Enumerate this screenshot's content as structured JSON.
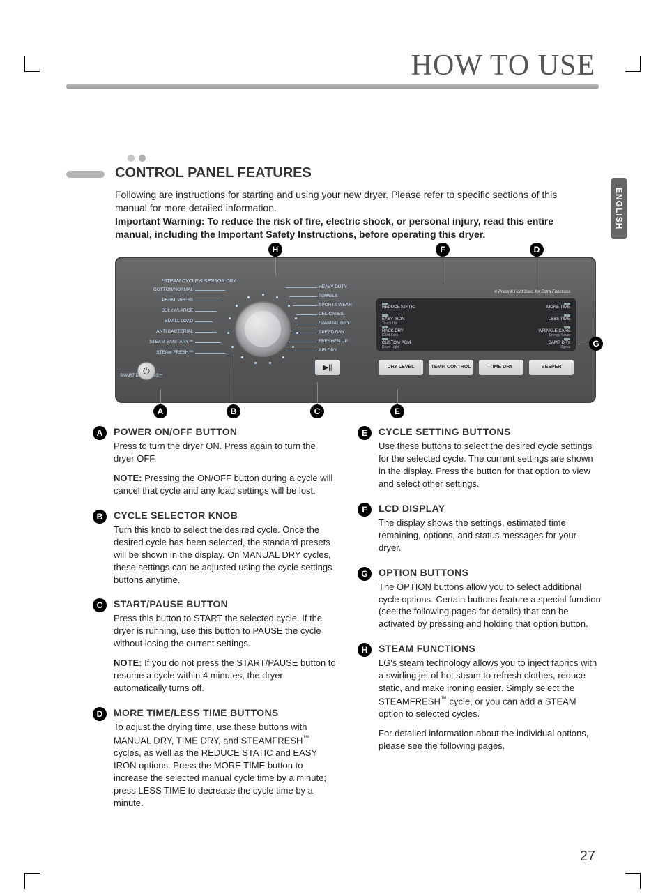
{
  "page_title": "HOW TO USE",
  "language_tab": "ENGLISH",
  "page_number": "27",
  "section_heading": "CONTROL PANEL FEATURES",
  "intro_text": "Following are instructions for starting and using your new dryer. Please refer to specific sections of this manual for more detailed information.",
  "warning_text": "Important Warning: To reduce the risk of fire, electric shock, or personal injury, read this entire manual, including the Important Safety Instructions, before operating this dryer.",
  "panel": {
    "steam_header": "*STEAM CYCLE & SENSOR DRY",
    "left_labels": [
      "COTTON/NORMAL",
      "PERM. PRESS",
      "BULKY/LARGE",
      "SMALL LOAD",
      "ANTI BACTERIAL",
      "STEAM SANITARY™",
      "STEAM FRESH™"
    ],
    "right_labels": [
      "HEAVY DUTY",
      "TOWELS",
      "SPORTS WEAR",
      "DELICATES",
      "*MANUAL DRY",
      "SPEED DRY",
      "FRESHEN UP",
      "AIR DRY"
    ],
    "hold_note": "※ Press & Hold 3sec. for Extra Functions",
    "lcd_left": [
      {
        "t": "REDUCE STATIC"
      },
      {
        "t": "EASY IRON",
        "s": "Touch Up"
      },
      {
        "t": "RACK DRY",
        "s": "Child Lock"
      },
      {
        "t": "CUSTOM PGM",
        "s": "Drum Light"
      }
    ],
    "lcd_right": [
      {
        "t": "MORE TIME"
      },
      {
        "t": "LESS TIME"
      },
      {
        "t": "WRINKLE CARE",
        "s": "Energy Saver"
      },
      {
        "t": "DAMP DRY",
        "s": "Signal"
      }
    ],
    "buttons": [
      "DRY LEVEL",
      "TEMP. CONTROL",
      "TIME DRY",
      "BEEPER"
    ],
    "power_icon": "⏻",
    "play_icon": "▶||",
    "smart_diag": "SMART DIAGNOSIS™"
  },
  "callouts": {
    "A": "A",
    "B": "B",
    "C": "C",
    "D": "D",
    "E": "E",
    "F": "F",
    "G": "G",
    "H": "H"
  },
  "features": [
    {
      "id": "A",
      "title": "POWER ON/OFF BUTTON",
      "paras": [
        "Press to turn the dryer ON. Press again to turn the dryer OFF.",
        "<span class='nb'>NOTE:</span> Pressing the ON/OFF button during a cycle will cancel that cycle and any load settings will be lost."
      ]
    },
    {
      "id": "B",
      "title": "CYCLE SELECTOR KNOB",
      "paras": [
        "Turn this knob to select the desired cycle. Once the desired cycle has been selected, the standard presets will be shown in the display. On MANUAL DRY cycles, these settings can be adjusted using the cycle settings buttons anytime."
      ]
    },
    {
      "id": "C",
      "title": "START/PAUSE BUTTON",
      "paras": [
        "Press this button to START the selected cycle. If the dryer is running, use this button to PAUSE the cycle without losing the current settings.",
        "<span class='nb'>NOTE:</span> If you do not press the START/PAUSE button to resume a cycle within 4 minutes, the dryer automatically turns off."
      ]
    },
    {
      "id": "D",
      "title": "MORE TIME/LESS TIME BUTTONS",
      "paras": [
        "To adjust the drying time, use these buttons with MANUAL DRY, TIME DRY, and STEAMFRESH<sup>™</sup> cycles, as well as the REDUCE STATIC and EASY IRON options. Press the MORE TIME button to increase the selected manual cycle time by a minute; press LESS TIME to decrease the cycle time by a minute."
      ]
    },
    {
      "id": "E",
      "title": "CYCLE SETTING BUTTONS",
      "paras": [
        "Use these buttons to select the desired cycle settings for the selected cycle. The current settings are shown in the display. Press the button for that option to view and select other settings."
      ]
    },
    {
      "id": "F",
      "title": "LCD DISPLAY",
      "paras": [
        "The display shows the settings, estimated time remaining, options, and status messages for your dryer."
      ]
    },
    {
      "id": "G",
      "title": "OPTION BUTTONS",
      "paras": [
        "The OPTION buttons allow you to select additional cycle options. Certain buttons feature a special function (see the following pages for details) that can be activated by pressing and holding that option button."
      ]
    },
    {
      "id": "H",
      "title": "STEAM FUNCTIONS",
      "paras": [
        "LG's steam technology allows you to inject fabrics with a swirling jet of hot steam to refresh clothes, reduce static, and make ironing easier. Simply select the STEAMFRESH<sup>™</sup> cycle, or you can add a STEAM option to selected cycles.",
        "For detailed information about the individual options, please see the following pages."
      ]
    }
  ]
}
